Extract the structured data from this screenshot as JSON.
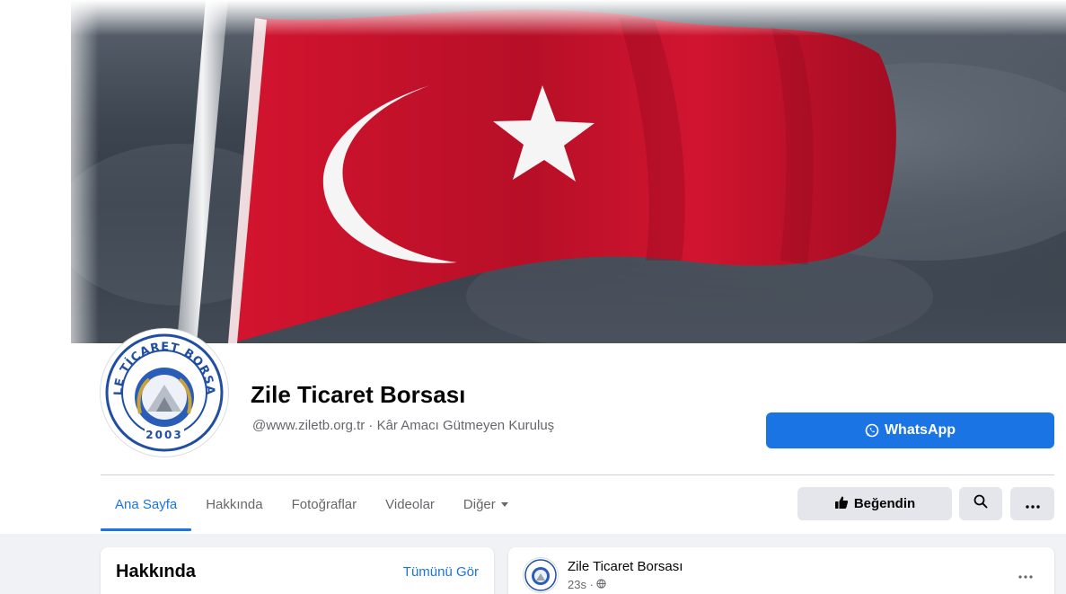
{
  "page": {
    "name": "Zile Ticaret Borsası",
    "subtitle": "@www.ziletb.org.tr · Kâr Amacı Gütmeyen Kuruluş"
  },
  "logo": {
    "ring_text": "ZİLE TİCARET BORSASI",
    "year": "2003"
  },
  "actions": {
    "whatsapp_label": "WhatsApp",
    "like_label": "Beğendin"
  },
  "tabs": [
    {
      "label": "Ana Sayfa",
      "active": true
    },
    {
      "label": "Hakkında",
      "active": false
    },
    {
      "label": "Fotoğraflar",
      "active": false
    },
    {
      "label": "Videolar",
      "active": false
    },
    {
      "label": "Diğer",
      "active": false
    }
  ],
  "about": {
    "title": "Hakkında",
    "see_all": "Tümünü Gör"
  },
  "post": {
    "author": "Zile Ticaret Borsası",
    "time": "23s ·"
  },
  "colors": {
    "accent": "#1b74e4",
    "flag_red": "#c8102e",
    "logo_blue": "#1f4ea3",
    "background": "#f0f2f5"
  },
  "icons": {
    "whatsapp": "whatsapp-icon",
    "like": "thumbs-up-icon",
    "search": "search-icon",
    "more": "ellipsis-icon",
    "globe": "globe-icon"
  }
}
